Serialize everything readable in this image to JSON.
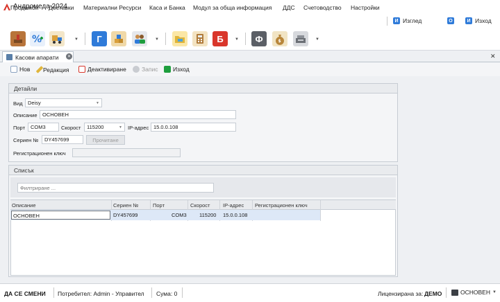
{
  "app": {
    "title": "Андромеда 2024"
  },
  "menu": {
    "items": [
      "Продажби",
      "Доставки",
      "Материални Ресурси",
      "Каса и Банка",
      "Модул за обща информация",
      "ДДС",
      "Счетоводство",
      "Настройки"
    ],
    "view": {
      "badge": "И",
      "label": "Изглед"
    },
    "info_badge": "О",
    "exit": {
      "badge": "И",
      "label": "Изход"
    }
  },
  "toolbar": {
    "icons": [
      "stamp-icon",
      "percent-tag-icon",
      "delivery-icon",
      "general-ledger-icon",
      "warehouse-icon",
      "people-icon",
      "folder-icon",
      "calculator-icon",
      "bank-icon",
      "fixed-assets-icon",
      "money-bag-icon",
      "cash-register-icon"
    ],
    "letters": {
      "general": "Г",
      "bank": "Б",
      "fixed": "Ф"
    }
  },
  "tab": {
    "label": "Касови апарати"
  },
  "actions": {
    "new": "Нов",
    "edit": "Редакция",
    "deactivate": "Деактивиране",
    "save": "Запис",
    "exit": "Изход"
  },
  "details": {
    "title": "Детайли",
    "kind_label": "Вид",
    "kind_value": "Deisy",
    "description_label": "Описание",
    "description_value": "ОСНОВЕН",
    "port_label": "Порт",
    "port_value": "COM3",
    "speed_label": "Скорост",
    "speed_value": "115200",
    "ip_label": "IP-адрес",
    "ip_value": "15.0.0.108",
    "serial_label": "Сериен №",
    "serial_value": "DY457699",
    "read_button": "Прочитане",
    "reg_key_label": "Регистрационен ключ",
    "reg_key_value": ""
  },
  "list": {
    "title": "Списък",
    "filter_placeholder": "Филтриране ...",
    "columns": [
      "Описание",
      "Сериен №",
      "Порт",
      "Скорост",
      "IP-адрес",
      "Регистрационен ключ"
    ],
    "rows": [
      {
        "description": "ОСНОВЕН",
        "serial": "DY457699",
        "port": "COM3",
        "speed": "115200",
        "ip": "15.0.0.108",
        "reg_key": ""
      }
    ]
  },
  "status": {
    "brand": "ДА СЕ СМЕНИ",
    "user": "Потребител: Admin - Управител",
    "sum": "Сума: 0",
    "license_label": "Лицензирана за:",
    "license_value": "ДЕМО",
    "register": "ОСНОВЕН"
  },
  "colors": {
    "accent": "#2f7bd9",
    "red": "#d9362b",
    "grey_letter": "#5b5f66",
    "selection": "#dde8f7"
  }
}
